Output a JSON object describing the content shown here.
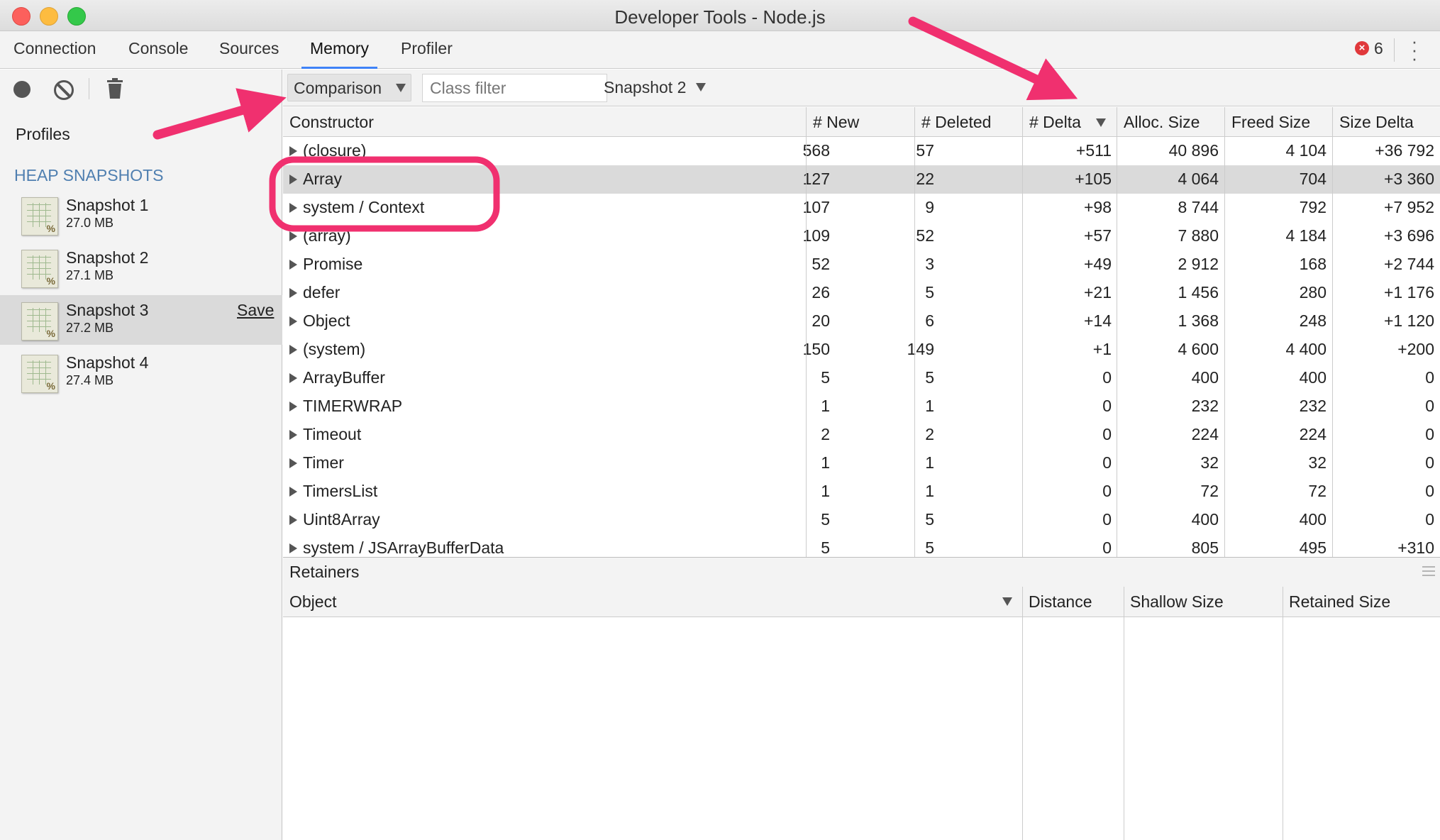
{
  "window": {
    "title": "Developer Tools - Node.js"
  },
  "tabs": [
    {
      "label": "Connection",
      "active": false
    },
    {
      "label": "Console",
      "active": false
    },
    {
      "label": "Sources",
      "active": false
    },
    {
      "label": "Memory",
      "active": true
    },
    {
      "label": "Profiler",
      "active": false
    }
  ],
  "errors": {
    "icon": "error-x-icon",
    "count": "6"
  },
  "sidebar": {
    "profiles_label": "Profiles",
    "section_header": "HEAP SNAPSHOTS",
    "snapshots": [
      {
        "name": "Snapshot 1",
        "size": "27.0 MB"
      },
      {
        "name": "Snapshot 2",
        "size": "27.1 MB"
      },
      {
        "name": "Snapshot 3",
        "size": "27.2 MB",
        "save_label": "Save",
        "selected": true
      },
      {
        "name": "Snapshot 4",
        "size": "27.4 MB"
      }
    ],
    "snapshot_icon_mark": "%"
  },
  "toolbar": {
    "view_select": "Comparison",
    "class_filter_placeholder": "Class filter",
    "base_snapshot": "Snapshot 2"
  },
  "grid": {
    "columns": [
      "Constructor",
      "# New",
      "# Deleted",
      "# Delta",
      "Alloc. Size",
      "Freed Size",
      "Size Delta"
    ],
    "sorted_column": "# Delta",
    "rows": [
      [
        "(closure)",
        "568",
        "57",
        "+511",
        "40 896",
        "4 104",
        "+36 792"
      ],
      [
        "Array",
        "127",
        "22",
        "+105",
        "4 064",
        "704",
        "+3 360"
      ],
      [
        "system / Context",
        "107",
        "9",
        "+98",
        "8 744",
        "792",
        "+7 952"
      ],
      [
        "(array)",
        "109",
        "52",
        "+57",
        "7 880",
        "4 184",
        "+3 696"
      ],
      [
        "Promise",
        "52",
        "3",
        "+49",
        "2 912",
        "168",
        "+2 744"
      ],
      [
        "defer",
        "26",
        "5",
        "+21",
        "1 456",
        "280",
        "+1 176"
      ],
      [
        "Object",
        "20",
        "6",
        "+14",
        "1 368",
        "248",
        "+1 120"
      ],
      [
        "(system)",
        "150",
        "149",
        "+1",
        "4 600",
        "4 400",
        "+200"
      ],
      [
        "ArrayBuffer",
        "5",
        "5",
        "0",
        "400",
        "400",
        "0"
      ],
      [
        "TIMERWRAP",
        "1",
        "1",
        "0",
        "232",
        "232",
        "0"
      ],
      [
        "Timeout",
        "2",
        "2",
        "0",
        "224",
        "224",
        "0"
      ],
      [
        "Timer",
        "1",
        "1",
        "0",
        "32",
        "32",
        "0"
      ],
      [
        "TimersList",
        "1",
        "1",
        "0",
        "72",
        "72",
        "0"
      ],
      [
        "Uint8Array",
        "5",
        "5",
        "0",
        "400",
        "400",
        "0"
      ],
      [
        "system / JSArrayBufferData",
        "5",
        "5",
        "0",
        "805",
        "495",
        "+310"
      ]
    ],
    "selected_row": 1
  },
  "retainers": {
    "title": "Retainers",
    "columns": [
      "Object",
      "Distance",
      "Shallow Size",
      "Retained Size"
    ]
  },
  "colors": {
    "annotation": "#f0306f",
    "active_tab_underline": "#3e82f7",
    "section_header": "#4f7fb0",
    "selected_row": "#dadada"
  }
}
